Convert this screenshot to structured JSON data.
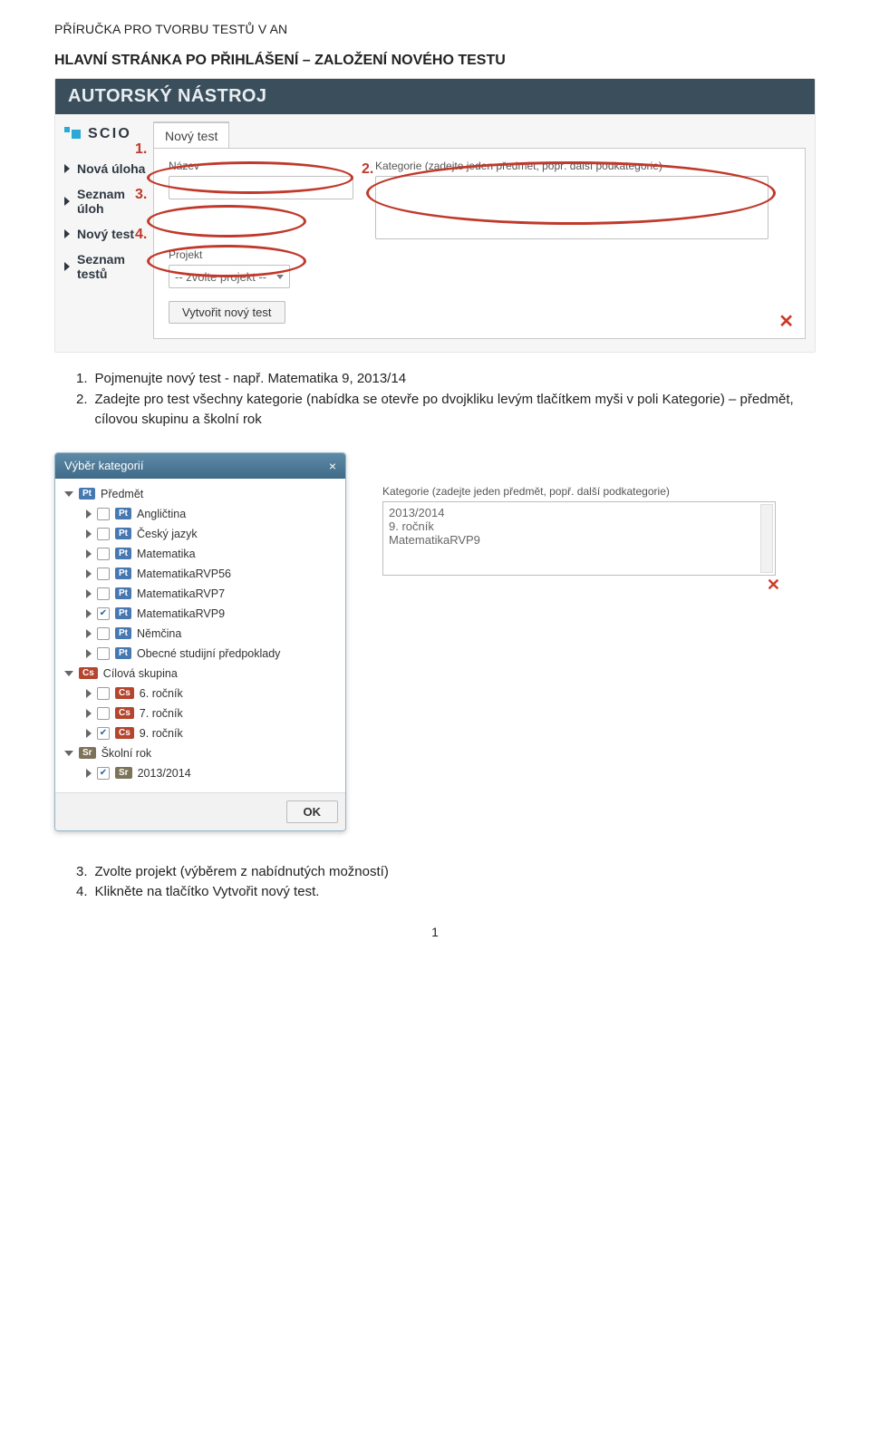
{
  "doc": {
    "top_header": "PŘÍRUČKA PRO TVORBU TESTŮ V AN",
    "heading": "HLAVNÍ STRÁNKA PO PŘIHLÁŠENÍ – ZALOŽENÍ  NOVÉHO TESTU"
  },
  "shot1": {
    "title": "AUTORSKÝ NÁSTROJ",
    "logo": "SCIO",
    "nav": [
      "Nová úloha",
      "Seznam úloh",
      "Nový test",
      "Seznam testů"
    ],
    "tab": "Nový test",
    "label_name": "Název",
    "label_project": "Projekt",
    "project_placeholder": "-- zvolte projekt --",
    "label_cat": "Kategorie (zadejte jeden předmět, popř. další podkategorie)",
    "create_btn": "Vytvořit nový test",
    "marks": {
      "n1": "1.",
      "n2": "2.",
      "n3": "3.",
      "n4": "4."
    },
    "delete_icon": "✕"
  },
  "instr1": [
    {
      "n": "1.",
      "t": "Pojmenujte nový test  - např. Matematika 9, 2013/14"
    },
    {
      "n": "2.",
      "t": "Zadejte pro test všechny kategorie (nabídka se otevře po dvojkliku levým tlačítkem myši v poli Kategorie) – předmět, cílovou skupinu a školní rok"
    }
  ],
  "dialog": {
    "title": "Výběr kategorií",
    "close": "×",
    "groups": [
      {
        "tag": "Pt",
        "label": "Předmět",
        "open": true,
        "items": [
          {
            "label": "Angličtina",
            "checked": false
          },
          {
            "label": "Český jazyk",
            "checked": false
          },
          {
            "label": "Matematika",
            "checked": false
          },
          {
            "label": "MatematikaRVP56",
            "checked": false
          },
          {
            "label": "MatematikaRVP7",
            "checked": false
          },
          {
            "label": "MatematikaRVP9",
            "checked": true
          },
          {
            "label": "Němčina",
            "checked": false
          },
          {
            "label": "Obecné studijní předpoklady",
            "checked": false
          }
        ]
      },
      {
        "tag": "Cs",
        "label": "Cílová skupina",
        "open": true,
        "items": [
          {
            "label": "6. ročník",
            "checked": false
          },
          {
            "label": "7. ročník",
            "checked": false
          },
          {
            "label": "9. ročník",
            "checked": true
          }
        ]
      },
      {
        "tag": "Sr",
        "label": "Školní rok",
        "open": true,
        "items": [
          {
            "label": "2013/2014",
            "checked": true
          }
        ]
      }
    ],
    "ok": "OK"
  },
  "catbox": {
    "label": "Kategorie (zadejte jeden předmět, popř. další podkategorie)",
    "lines": [
      "2013/2014",
      "9. ročník",
      "MatematikaRVP9"
    ],
    "delete_icon": "✕"
  },
  "instr2": [
    {
      "n": "3.",
      "t": "Zvolte projekt (výběrem z nabídnutých možností)"
    },
    {
      "n": "4.",
      "t": "Klikněte na tlačítko  Vytvořit nový test."
    }
  ],
  "page_number": "1"
}
